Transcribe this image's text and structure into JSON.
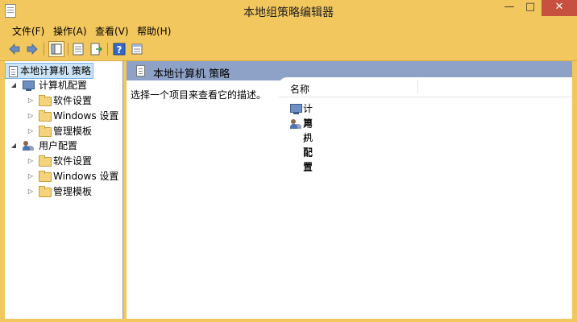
{
  "window": {
    "title": "本地组策略编辑器",
    "controls": {
      "minimize": "—",
      "maximize": "□",
      "close": "✕"
    }
  },
  "menu": [
    {
      "label": "文件(F)"
    },
    {
      "label": "操作(A)"
    },
    {
      "label": "查看(V)"
    },
    {
      "label": "帮助(H)"
    }
  ],
  "toolbar": {
    "buttons": [
      "back-arrow-icon",
      "forward-arrow-icon",
      "show-hide-tree-icon",
      "properties-icon",
      "export-list-icon",
      "help-icon",
      "view-icon"
    ],
    "colors": {
      "arrow": "#6b8bb8",
      "help": "#3468c8"
    }
  },
  "tree": {
    "root": {
      "label": "本地计算机 策略"
    },
    "computer": {
      "label": "计算机配置",
      "children": [
        {
          "label": "软件设置"
        },
        {
          "label": "Windows 设置"
        },
        {
          "label": "管理模板"
        }
      ]
    },
    "user": {
      "label": "用户配置",
      "children": [
        {
          "label": "软件设置"
        },
        {
          "label": "Windows 设置"
        },
        {
          "label": "管理模板"
        }
      ]
    }
  },
  "details": {
    "header_title": "本地计算机 策略",
    "description": "选择一个项目来查看它的描述。",
    "column_name": "名称",
    "items": [
      {
        "label": "计算机配置",
        "icon": "computer-icon"
      },
      {
        "label": "用户配置",
        "icon": "users-icon"
      }
    ]
  },
  "colors": {
    "chrome": "#f2c75d",
    "header": "#8ea2c8",
    "selection": "#cce4f7",
    "close": "#c7503f"
  }
}
